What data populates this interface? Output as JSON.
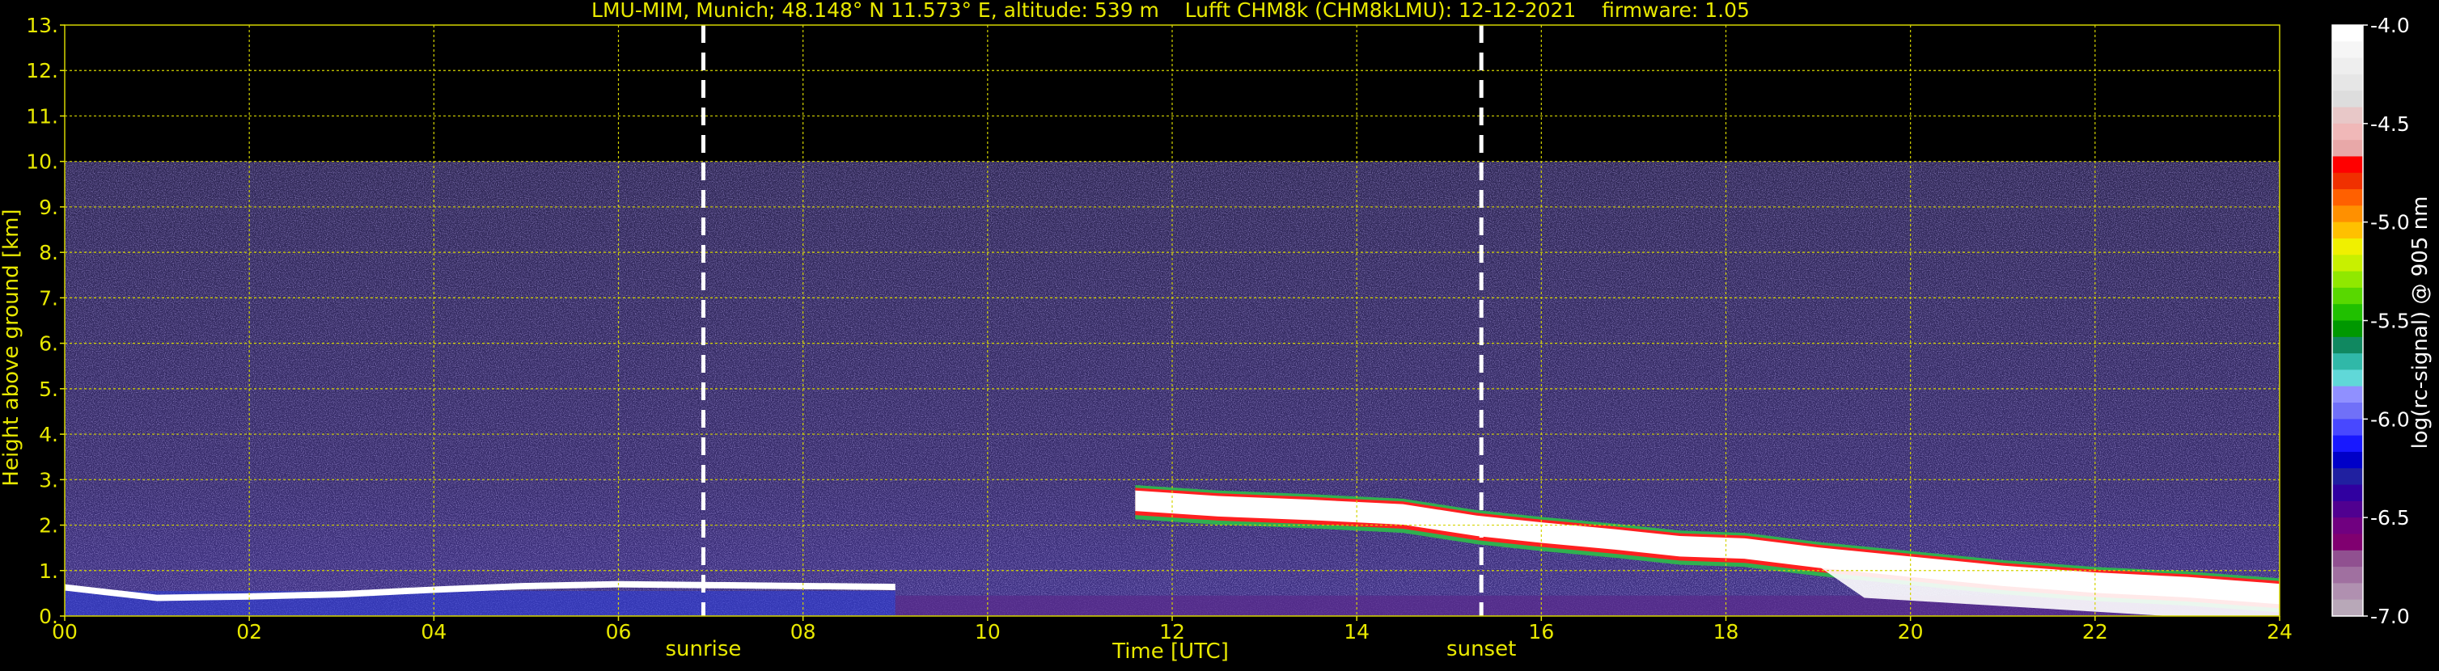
{
  "chart_data": {
    "type": "heatmap",
    "title": "LMU-MIM, Munich; 48.148° N 11.573° E, altitude: 539 m    Lufft CHM8k (CHM8kLMU): 12-12-2021    firmware: 1.05",
    "xlabel": "Time [UTC]",
    "ylabel": "Height above ground [km]",
    "xlim": [
      0,
      24
    ],
    "ylim": [
      0,
      13
    ],
    "x_ticks": [
      "00",
      "02",
      "04",
      "06",
      "08",
      "10",
      "12",
      "14",
      "16",
      "18",
      "20",
      "22",
      "24"
    ],
    "y_ticks": [
      "0.",
      "1.",
      "2.",
      "3.",
      "4.",
      "5.",
      "6.",
      "7.",
      "8.",
      "9.",
      "10.",
      "11.",
      "12.",
      "13."
    ],
    "grid": true,
    "grid_color": "#d4d400",
    "text_color": "#e8e800",
    "events": [
      {
        "label": "sunrise",
        "time": 6.92
      },
      {
        "label": "sunset",
        "time": 15.35
      }
    ],
    "colorbar": {
      "label": "log(rc-signal) @ 905 nm",
      "range": [
        -7.0,
        -4.0
      ],
      "ticks": [
        "-4.0",
        "-4.5",
        "-5.0",
        "-5.5",
        "-6.0",
        "-6.5",
        "-7.0"
      ],
      "colors": [
        "#ffffff",
        "#f6f6f6",
        "#eeeeee",
        "#e6e6e6",
        "#dddddd",
        "#e8c8c8",
        "#f0b8b8",
        "#e8a8a8",
        "#ff0000",
        "#f03000",
        "#ff6000",
        "#ff9000",
        "#ffc000",
        "#f0f000",
        "#c8f000",
        "#90e800",
        "#58d800",
        "#20c000",
        "#009800",
        "#108860",
        "#30b8a8",
        "#60d8d8",
        "#9090ff",
        "#7070f8",
        "#4848ff",
        "#1818ff",
        "#0000c8",
        "#2020a0",
        "#3000a0",
        "#500090",
        "#700080",
        "#800070",
        "#905090",
        "#a070a0",
        "#b090b0",
        "#b8a8b8"
      ]
    },
    "signal_top_km": 10.0,
    "cloud_layer": [
      {
        "x": 11.6,
        "y": 2.6
      },
      {
        "x": 12.5,
        "y": 2.48
      },
      {
        "x": 13.5,
        "y": 2.4
      },
      {
        "x": 14.5,
        "y": 2.3
      },
      {
        "x": 15.3,
        "y": 2.05
      },
      {
        "x": 16.0,
        "y": 1.9
      },
      {
        "x": 16.8,
        "y": 1.75
      },
      {
        "x": 17.5,
        "y": 1.6
      },
      {
        "x": 18.2,
        "y": 1.55
      },
      {
        "x": 19.0,
        "y": 1.35
      },
      {
        "x": 20.0,
        "y": 1.15
      },
      {
        "x": 21.0,
        "y": 0.95
      },
      {
        "x": 22.0,
        "y": 0.8
      },
      {
        "x": 23.0,
        "y": 0.7
      },
      {
        "x": 24.0,
        "y": 0.55
      }
    ],
    "boundary_layer": [
      {
        "x": 0.0,
        "y": 0.65
      },
      {
        "x": 1.0,
        "y": 0.42
      },
      {
        "x": 2.0,
        "y": 0.45
      },
      {
        "x": 3.0,
        "y": 0.5
      },
      {
        "x": 4.0,
        "y": 0.6
      },
      {
        "x": 5.0,
        "y": 0.68
      },
      {
        "x": 6.0,
        "y": 0.72
      },
      {
        "x": 7.0,
        "y": 0.7
      },
      {
        "x": 8.0,
        "y": 0.68
      },
      {
        "x": 9.0,
        "y": 0.66
      }
    ]
  }
}
